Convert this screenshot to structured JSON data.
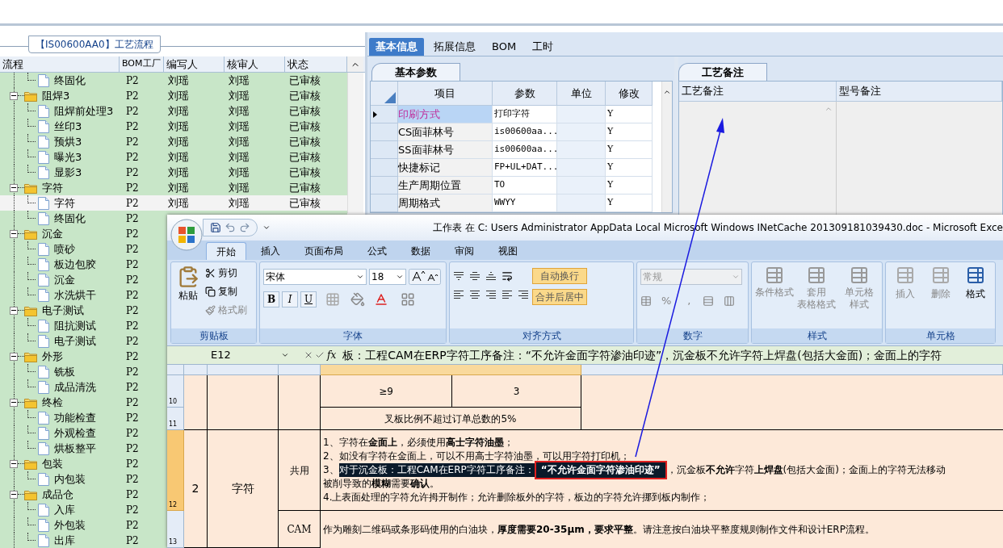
{
  "left_panel": {
    "group_title": "【IS00600AA0】工艺流程",
    "columns": [
      "流程",
      "BOM工厂",
      "编写人",
      "核审人",
      "状态"
    ],
    "tree": [
      {
        "children": [
          {
            "name": "终固化",
            "bom": "P2",
            "author": "刘瑶",
            "reviewer": "刘瑶",
            "status": "已审核",
            "selected": false
          }
        ]
      },
      {
        "name": "阻焊3",
        "bom": "P2",
        "author": "刘瑶",
        "reviewer": "刘瑶",
        "status": "已审核",
        "selected": false,
        "expanded": true,
        "children": [
          {
            "name": "阻焊前处理3",
            "bom": "P2",
            "author": "刘瑶",
            "reviewer": "刘瑶",
            "status": "已审核",
            "selected": false
          },
          {
            "name": "丝印3",
            "bom": "P2",
            "author": "刘瑶",
            "reviewer": "刘瑶",
            "status": "已审核",
            "selected": false
          },
          {
            "name": "预烘3",
            "bom": "P2",
            "author": "刘瑶",
            "reviewer": "刘瑶",
            "status": "已审核",
            "selected": false
          },
          {
            "name": "曝光3",
            "bom": "P2",
            "author": "刘瑶",
            "reviewer": "刘瑶",
            "status": "已审核",
            "selected": false
          },
          {
            "name": "显影3",
            "bom": "P2",
            "author": "刘瑶",
            "reviewer": "刘瑶",
            "status": "已审核",
            "selected": false
          }
        ]
      },
      {
        "name": "字符",
        "bom": "P2",
        "author": "刘瑶",
        "reviewer": "刘瑶",
        "status": "已审核",
        "selected": false,
        "expanded": true,
        "children": [
          {
            "name": "字符",
            "bom": "P2",
            "author": "刘瑶",
            "reviewer": "刘瑶",
            "status": "已审核",
            "selected": true
          },
          {
            "name": "终固化",
            "bom": "P2",
            "selected": false
          }
        ]
      },
      {
        "name": "沉金",
        "bom": "P2",
        "selected": false,
        "expanded": true,
        "children": [
          {
            "name": "喷砂",
            "bom": "P2",
            "selected": false
          },
          {
            "name": "板边包胶",
            "bom": "P2",
            "selected": false
          },
          {
            "name": "沉金",
            "bom": "P2",
            "selected": false
          },
          {
            "name": "水洗烘干",
            "bom": "P2",
            "selected": false
          }
        ]
      },
      {
        "name": "电子测试",
        "bom": "P2",
        "selected": false,
        "expanded": true,
        "children": [
          {
            "name": "阻抗测试",
            "bom": "P2",
            "selected": false
          },
          {
            "name": "电子测试",
            "bom": "P2",
            "selected": false
          }
        ]
      },
      {
        "name": "外形",
        "bom": "P2",
        "selected": false,
        "expanded": true,
        "children": [
          {
            "name": "铣板",
            "bom": "P2",
            "selected": false
          },
          {
            "name": "成品清洗",
            "bom": "P2",
            "selected": false
          }
        ]
      },
      {
        "name": "终检",
        "bom": "P2",
        "selected": false,
        "expanded": true,
        "children": [
          {
            "name": "功能检查",
            "bom": "P2",
            "selected": false
          },
          {
            "name": "外观检查",
            "bom": "P2",
            "selected": false
          },
          {
            "name": "烘板整平",
            "bom": "P2",
            "selected": false
          }
        ]
      },
      {
        "name": "包装",
        "bom": "P2",
        "selected": false,
        "expanded": true,
        "children": [
          {
            "name": "内包装",
            "bom": "P2",
            "selected": false
          }
        ]
      },
      {
        "name": "成品仓",
        "bom": "P2",
        "selected": false,
        "expanded": true,
        "children": [
          {
            "name": "入库",
            "bom": "P2",
            "selected": false
          },
          {
            "name": "外包装",
            "bom": "P2",
            "selected": false
          },
          {
            "name": "出库",
            "bom": "P2",
            "selected": false
          }
        ]
      }
    ]
  },
  "detail_tabs": [
    {
      "label": "基本信息",
      "selected": true
    },
    {
      "label": "拓展信息",
      "selected": false
    },
    {
      "label": "BOM",
      "selected": false
    },
    {
      "label": "工时",
      "selected": false
    }
  ],
  "params_panel": {
    "tab": "基本参数",
    "columns": [
      "项目",
      "参数",
      "单位",
      "修改"
    ],
    "rows": [
      {
        "item": "印刷方式",
        "value": "打印字符",
        "modify": "Y",
        "selected": true
      },
      {
        "item": "CS面菲林号",
        "value": "is00600aa...",
        "modify": "Y",
        "selected": false
      },
      {
        "item": "SS面菲林号",
        "value": "is00600aa...",
        "modify": "Y",
        "selected": false
      },
      {
        "item": "快捷标记",
        "value": "FP+UL+DAT...",
        "modify": "Y",
        "selected": false
      },
      {
        "item": "生产周期位置",
        "value": "TO",
        "modify": "Y",
        "selected": false
      },
      {
        "item": "周期格式",
        "value": "WWYY",
        "modify": "Y",
        "selected": false
      }
    ]
  },
  "notes_panel": {
    "tab": "工艺备注",
    "columns": [
      "工艺备注",
      "型号备注"
    ]
  },
  "excel": {
    "title": "工作表 在 C: Users Administrator AppData Local Microsoft Windows INetCache 201309181039430.doc - Microsoft Exce",
    "ribbon_tabs": [
      {
        "label": "开始",
        "selected": true
      },
      {
        "label": "插入",
        "selected": false
      },
      {
        "label": "页面布局",
        "selected": false
      },
      {
        "label": "公式",
        "selected": false
      },
      {
        "label": "数据",
        "selected": false
      },
      {
        "label": "审阅",
        "selected": false
      },
      {
        "label": "视图",
        "selected": false
      }
    ],
    "clipboard": {
      "paste": "粘贴",
      "cut": "剪切",
      "copy": "复制",
      "format_painter": "格式刷",
      "label": "剪贴板"
    },
    "font": {
      "name": "宋体",
      "size": "18",
      "style_buttons": [
        "B",
        "I",
        "U"
      ],
      "label": "字体"
    },
    "alignment": {
      "wrap": "自动换行",
      "merge": "合并后居中",
      "label": "对齐方式"
    },
    "number": {
      "format": "常规",
      "percent": "%",
      "comma": ",",
      "label": "数字"
    },
    "styles": {
      "buttons": [
        {
          "lines": [
            "条件格式"
          ]
        },
        {
          "lines": [
            "套用",
            "表格格式"
          ]
        },
        {
          "lines": [
            "单元格",
            "样式"
          ]
        }
      ],
      "label": "样式"
    },
    "cells": {
      "buttons": [
        "插入",
        "删除",
        "格式"
      ],
      "label": "单元格"
    },
    "name_box": "E12",
    "fx": "fx",
    "formula": "板：工程CAM在ERP字符工序备注：“不允许金面字符渗油印迹”，沉金板不允许字符上焊盘(包括大金面)；金面上的字符",
    "sheet": {
      "row_numbers": [
        "10",
        "11",
        "12",
        "13"
      ],
      "row10": [
        "≥9",
        "3"
      ],
      "row11": "叉板比例不超过订单总数的5%",
      "no": "2",
      "process": "字符",
      "common_label": "共用",
      "line1": "1、字符在**金面上**，必须使用**高士字符油墨**；",
      "line2": "2、如没有字符在金面上，可以不用高士字符油墨，可以用字符打印机；",
      "line3": {
        "prefix": "3、",
        "highlighted": "对于沉金板：工程CAM在ERP字符工序备注：",
        "boxed": "“不允许金面字符渗油印迹”",
        "rest": "，沉金板**不允许**字符**上焊盘**(包括大金面)；金面上的字符无法移动"
      },
      "line4": "被削导致的**模糊**需要**确认**。",
      "line5": "4.上表面处理的字符允许拇开制作；允许删除板外的字符，板边的字符允许挪到板内制作；",
      "cam_label": "CAM",
      "cam_text": "作为雕刻二维码或条形码使用的白油块，**厚度需要20-35μm，要求平整**。请注意按白油块平整度规则制作文件和设计ERP流程。"
    }
  }
}
